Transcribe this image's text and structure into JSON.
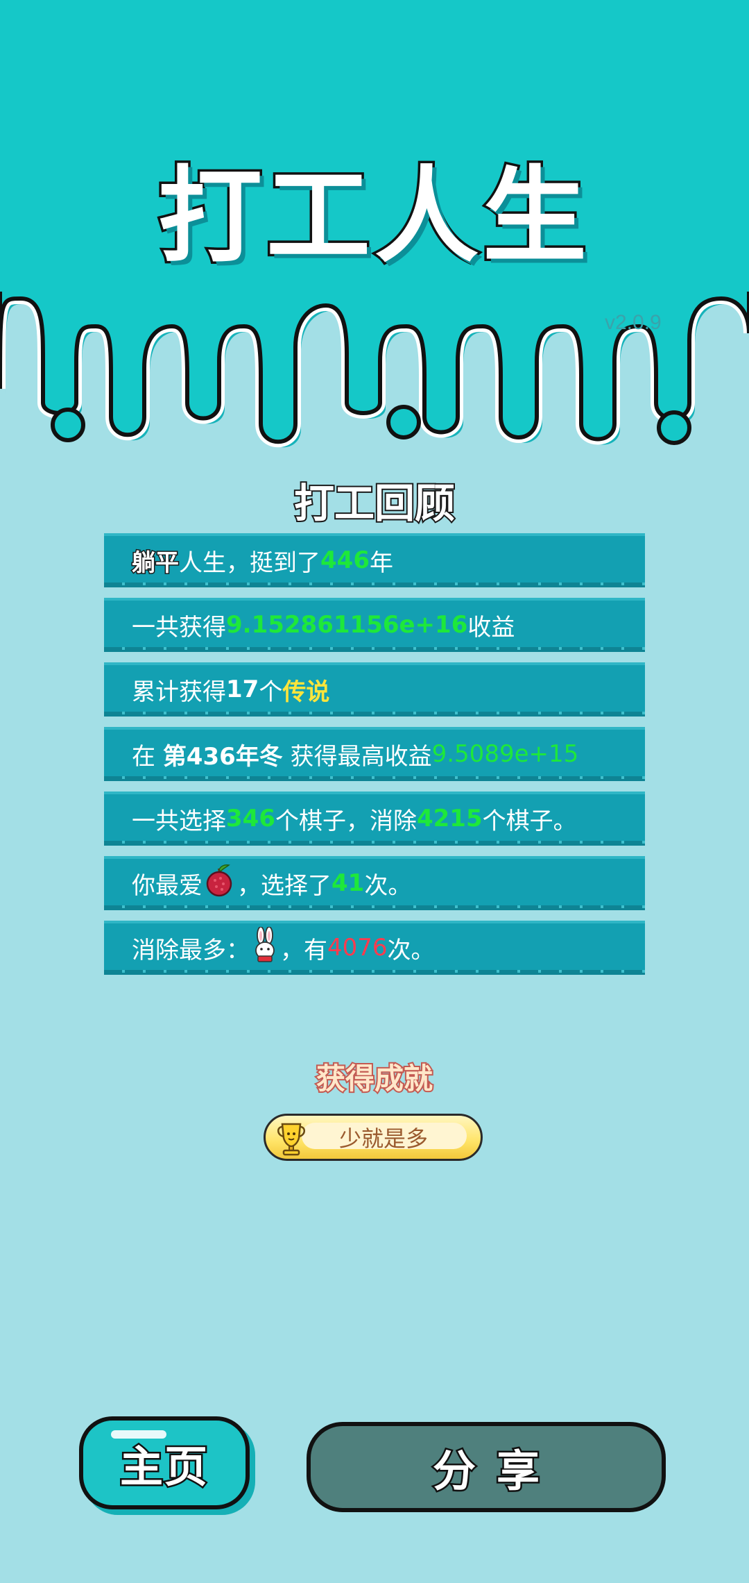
{
  "header": {
    "title": "打工人生",
    "version": "v2.0.9"
  },
  "review": {
    "title": "打工回顾",
    "rows": [
      {
        "parts": [
          "躺平",
          "人生，挺到了",
          "446",
          "年"
        ]
      },
      {
        "parts": [
          "一共获得",
          "9.152861156e+16",
          "收益"
        ]
      },
      {
        "parts": [
          "累计获得",
          "17",
          "个",
          "传说"
        ]
      },
      {
        "parts": [
          "在 ",
          "第436年冬",
          " 获得最高收益",
          "9.5089e+15"
        ]
      },
      {
        "parts": [
          "一共选择",
          "346",
          "个棋子，消除",
          "4215",
          "个棋子。"
        ]
      },
      {
        "parts": [
          "你最爱",
          "，选择了",
          "41",
          "次。"
        ],
        "icon": "lychee-icon"
      },
      {
        "parts": [
          "消除最多：",
          "，有",
          "4076",
          "次。"
        ],
        "icon": "rabbit-icon"
      }
    ]
  },
  "achievement": {
    "title": "获得成就",
    "badge_label": "少就是多",
    "badge_icon": "trophy-icon"
  },
  "buttons": {
    "home": "主页",
    "share": "分享"
  },
  "colors": {
    "top_band": "#15c8c8",
    "background": "#a3dfe6",
    "row": "#13a0b2",
    "highlight_green": "#1ee83a",
    "highlight_yellow": "#ffe53b",
    "highlight_red": "#ff3b4e"
  }
}
